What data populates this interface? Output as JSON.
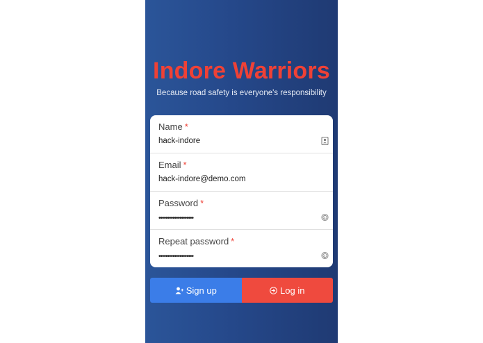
{
  "app": {
    "title": "Indore Warriors",
    "subtitle": "Because road safety is everyone's responsibility"
  },
  "form": {
    "required_mark": "*",
    "fields": [
      {
        "label": "Name",
        "value": "hack-indore",
        "icon": "contact-card-icon"
      },
      {
        "label": "Email",
        "value": "hack-indore@demo.com"
      },
      {
        "label": "Password",
        "value": "••••••••••••••••••••",
        "icon": "fingerprint-icon"
      },
      {
        "label": "Repeat password",
        "value": "••••••••••••••••••••",
        "icon": "fingerprint-icon"
      }
    ]
  },
  "buttons": {
    "signup_label": "Sign up",
    "signup_icon": "add-user-icon",
    "login_label": "Log in",
    "login_icon": "login-icon"
  },
  "colors": {
    "brand_red": "#ef4136",
    "signup_blue": "#3b7de8",
    "login_red": "#ef4a3e",
    "background_blue": "#25488a"
  }
}
